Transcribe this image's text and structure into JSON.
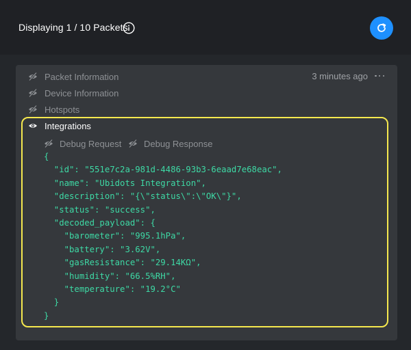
{
  "header": {
    "title": "Displaying 1 / 10 Packets",
    "info_icon": "info-circle-icon",
    "refresh_icon": "refresh-icon",
    "refresh_color": "#1e90ff"
  },
  "packet": {
    "timestamp": "3 minutes ago",
    "sections": [
      {
        "label": "Packet Information",
        "icon": "eye-off-icon",
        "visible": false
      },
      {
        "label": "Device Information",
        "icon": "eye-off-icon",
        "visible": false
      },
      {
        "label": "Hotspots",
        "icon": "eye-off-icon",
        "visible": false
      },
      {
        "label": "Integrations",
        "icon": "eye-icon",
        "visible": true
      }
    ],
    "debug": {
      "request_label": "Debug Request",
      "response_label": "Debug Response"
    },
    "json_lines": [
      "{",
      "  \"id\": \"551e7c2a-981d-4486-93b3-6eaad7e68eac\",",
      "  \"name\": \"Ubidots Integration\",",
      "  \"description\": \"{\\\"status\\\":\\\"OK\\\"}\",",
      "  \"status\": \"success\",",
      "  \"decoded_payload\": {",
      "    \"barometer\": \"995.1hPa\",",
      "    \"battery\": \"3.62V\",",
      "    \"gasResistance\": \"29.14KΩ\",",
      "    \"humidity\": \"66.5%RH\",",
      "    \"temperature\": \"19.2°C\"",
      "  }",
      "}"
    ],
    "highlight_color": "#f6e94e",
    "code_color": "#3ed9a5"
  }
}
